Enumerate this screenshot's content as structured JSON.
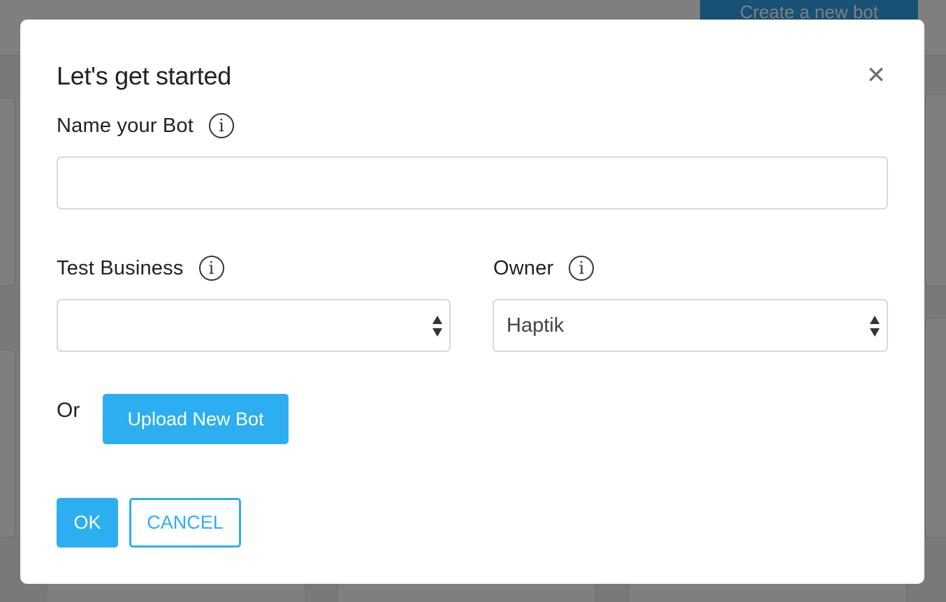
{
  "background": {
    "create_button_label": "Create a new bot"
  },
  "modal": {
    "title": "Let's get started",
    "close_icon": "close-icon",
    "name_field": {
      "label": "Name your Bot",
      "value": "",
      "placeholder": ""
    },
    "business_field": {
      "label": "Test Business",
      "selected": ""
    },
    "owner_field": {
      "label": "Owner",
      "selected": "Haptik"
    },
    "or_label": "Or",
    "upload_button_label": "Upload New Bot",
    "ok_button_label": "OK",
    "cancel_button_label": "CANCEL",
    "info_icon_glyph": "i"
  },
  "colors": {
    "accent": "#2caef0",
    "backdrop": "rgba(0,0,0,0.5)"
  }
}
